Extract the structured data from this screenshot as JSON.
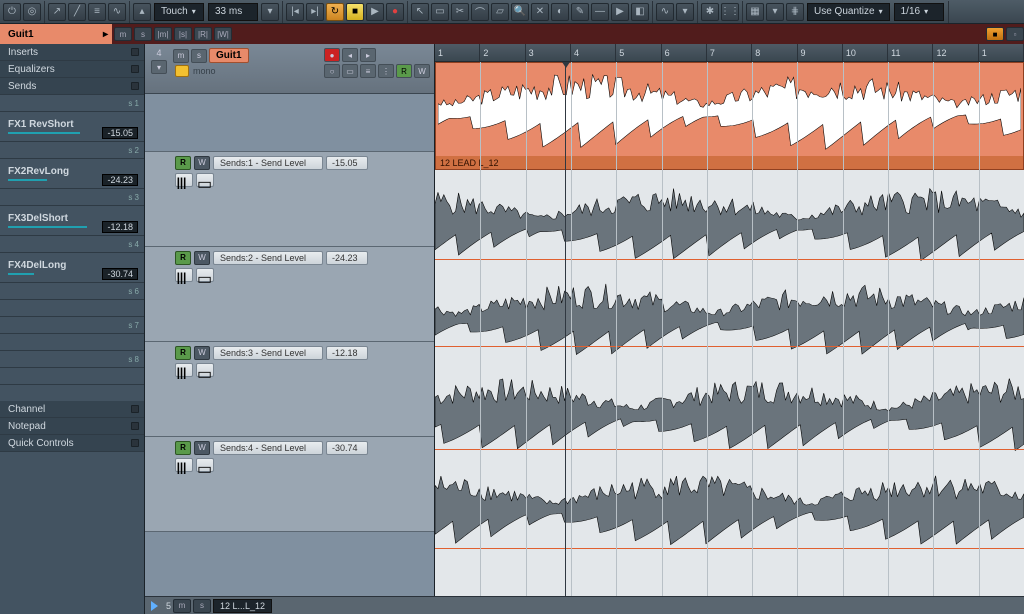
{
  "toolbar": {
    "automation_mode": "Touch",
    "automation_delay": "33 ms",
    "quantize_label": "Use Quantize",
    "quantize_value": "1/16"
  },
  "selected_track": {
    "name": "Guit1",
    "mono": "mono"
  },
  "inspector": {
    "sections": {
      "inserts": "Inserts",
      "equalizers": "Equalizers",
      "sends": "Sends",
      "channel": "Channel",
      "notepad": "Notepad",
      "quick": "Quick Controls"
    },
    "sends": [
      {
        "name": "FX1 RevShort",
        "value": "-15.05",
        "slot": "s 1",
        "bar": 55
      },
      {
        "name": "FX2RevLong",
        "value": "-24.23",
        "slot": "s 3",
        "bar": 30
      },
      {
        "name": "FX3DelShort",
        "value": "-12.18",
        "slot": "s 4",
        "bar": 60
      },
      {
        "name": "FX4DelLong",
        "value": "-30.74",
        "slot": "",
        "bar": 20
      }
    ],
    "empty_slots": [
      "s 2",
      "s 6",
      "s 7",
      "s 8"
    ]
  },
  "automation_lanes": [
    {
      "label": "Sends:1 - Send Level",
      "value": "-15.05"
    },
    {
      "label": "Sends:2 - Send Level",
      "value": "-24.23"
    },
    {
      "label": "Sends:3 - Send Level",
      "value": "-12.18"
    },
    {
      "label": "Sends:4 - Send Level",
      "value": "-30.74"
    }
  ],
  "ruler": [
    "1",
    "2",
    "3",
    "4",
    "5",
    "6",
    "7",
    "8",
    "9",
    "10",
    "11",
    "12",
    "1"
  ],
  "clip": {
    "name": "12 LEAD L_12"
  },
  "bottom": {
    "clip_name": "12 L...L_12",
    "track_num": "5"
  }
}
